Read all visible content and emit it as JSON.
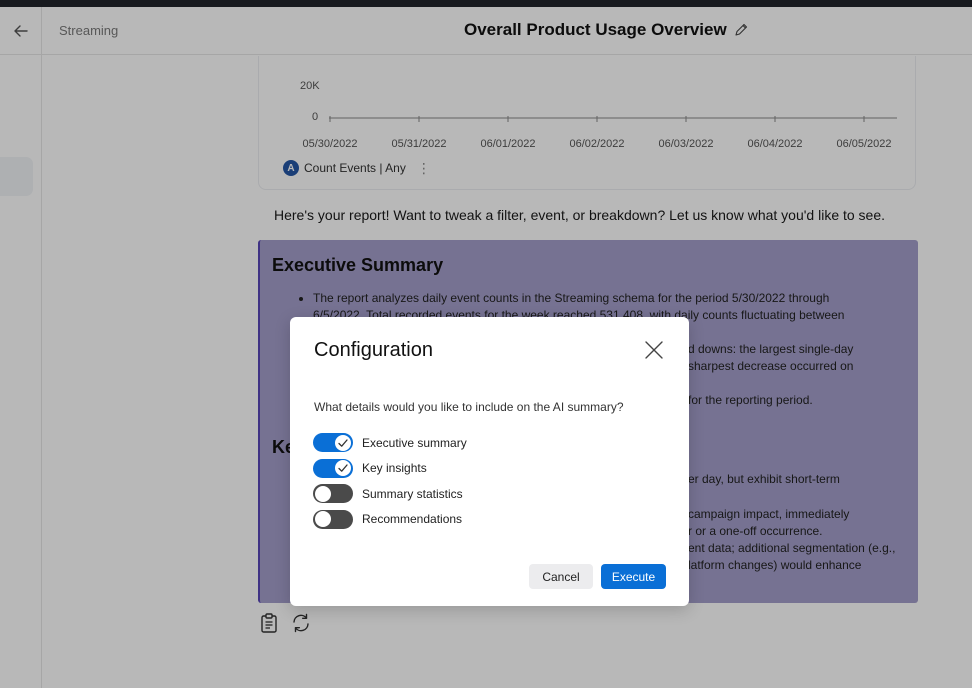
{
  "header": {
    "breadcrumb": "Streaming",
    "title": "Overall Product Usage Overview"
  },
  "chart": {
    "y_ticks": [
      "20K",
      "0"
    ],
    "x_ticks": [
      "05/30/2022",
      "05/31/2022",
      "06/01/2022",
      "06/02/2022",
      "06/03/2022",
      "06/04/2022",
      "06/05/2022"
    ],
    "legend_badge": "A",
    "legend_label": "Count Events | Any",
    "legend_more": "⋮"
  },
  "chart_data": {
    "type": "line",
    "x": [
      "05/30/2022",
      "05/31/2022",
      "06/01/2022",
      "06/02/2022",
      "06/03/2022",
      "06/04/2022",
      "06/05/2022"
    ],
    "y_ticks": [
      "20K",
      "0"
    ],
    "series": [
      {
        "name": "Count Events | Any"
      }
    ],
    "legend": "bottom-left"
  },
  "intro_text": "Here's your report! Want to tweak a filter, event, or breakdown? Let us know what you'd like to see.",
  "summary": {
    "title": "Executive Summary",
    "bullet1_line1": "The report analyzes daily event counts in the Streaming schema for the period 5/30/2022 through",
    "bullet1_line2": "6/5/2022. Total recorded events for the week reached 531,408, with daily counts fluctuating between",
    "frag1": "d downs: the largest single-day",
    "frag2": "sharpest decrease occurred on",
    "frag3": "for the reporting period.",
    "key_insights_partial": "Ke",
    "frag4": "er day, but exhibit short-term",
    "frag5": "campaign impact, immediately",
    "frag6": "r or a one-off occurrence.",
    "frag7": "ent data; additional segmentation (e.g.,",
    "frag8": "latform changes) would enhance"
  },
  "modal": {
    "title": "Configuration",
    "question": "What details would you like to include on the AI summary?",
    "options": [
      {
        "label": "Executive summary",
        "on": true
      },
      {
        "label": "Key insights",
        "on": true
      },
      {
        "label": "Summary statistics",
        "on": false
      },
      {
        "label": "Recommendations",
        "on": false
      }
    ],
    "cancel_label": "Cancel",
    "execute_label": "Execute"
  },
  "colors": {
    "accent": "#0a6fd6",
    "summary_bg": "#a49fcb",
    "summary_border": "#5846b7",
    "toggle_off": "#4a4a4a"
  }
}
